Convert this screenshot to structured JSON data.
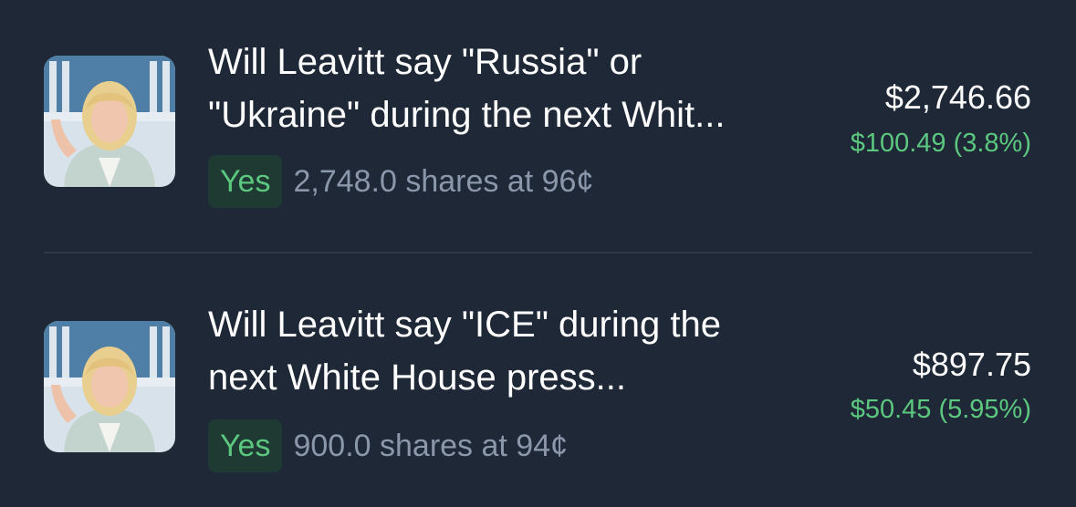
{
  "positions": [
    {
      "title_line1": "Will Leavitt say \"Russia\" or",
      "title_line2": "\"Ukraine\" during the next Whit...",
      "outcome": "Yes",
      "shares": "2,748.0 shares at 96¢",
      "value": "$2,746.66",
      "change": "$100.49 (3.8%)"
    },
    {
      "title_line1": "Will Leavitt say \"ICE\" during the",
      "title_line2": "next White House press...",
      "outcome": "Yes",
      "shares": "900.0 shares at 94¢",
      "value": "$897.75",
      "change": "$50.45 (5.95%)"
    }
  ],
  "colors": {
    "background": "#1e2837",
    "positive": "#5cc77f",
    "muted_text": "#8b97ab",
    "badge_bg": "#1e3a32"
  }
}
